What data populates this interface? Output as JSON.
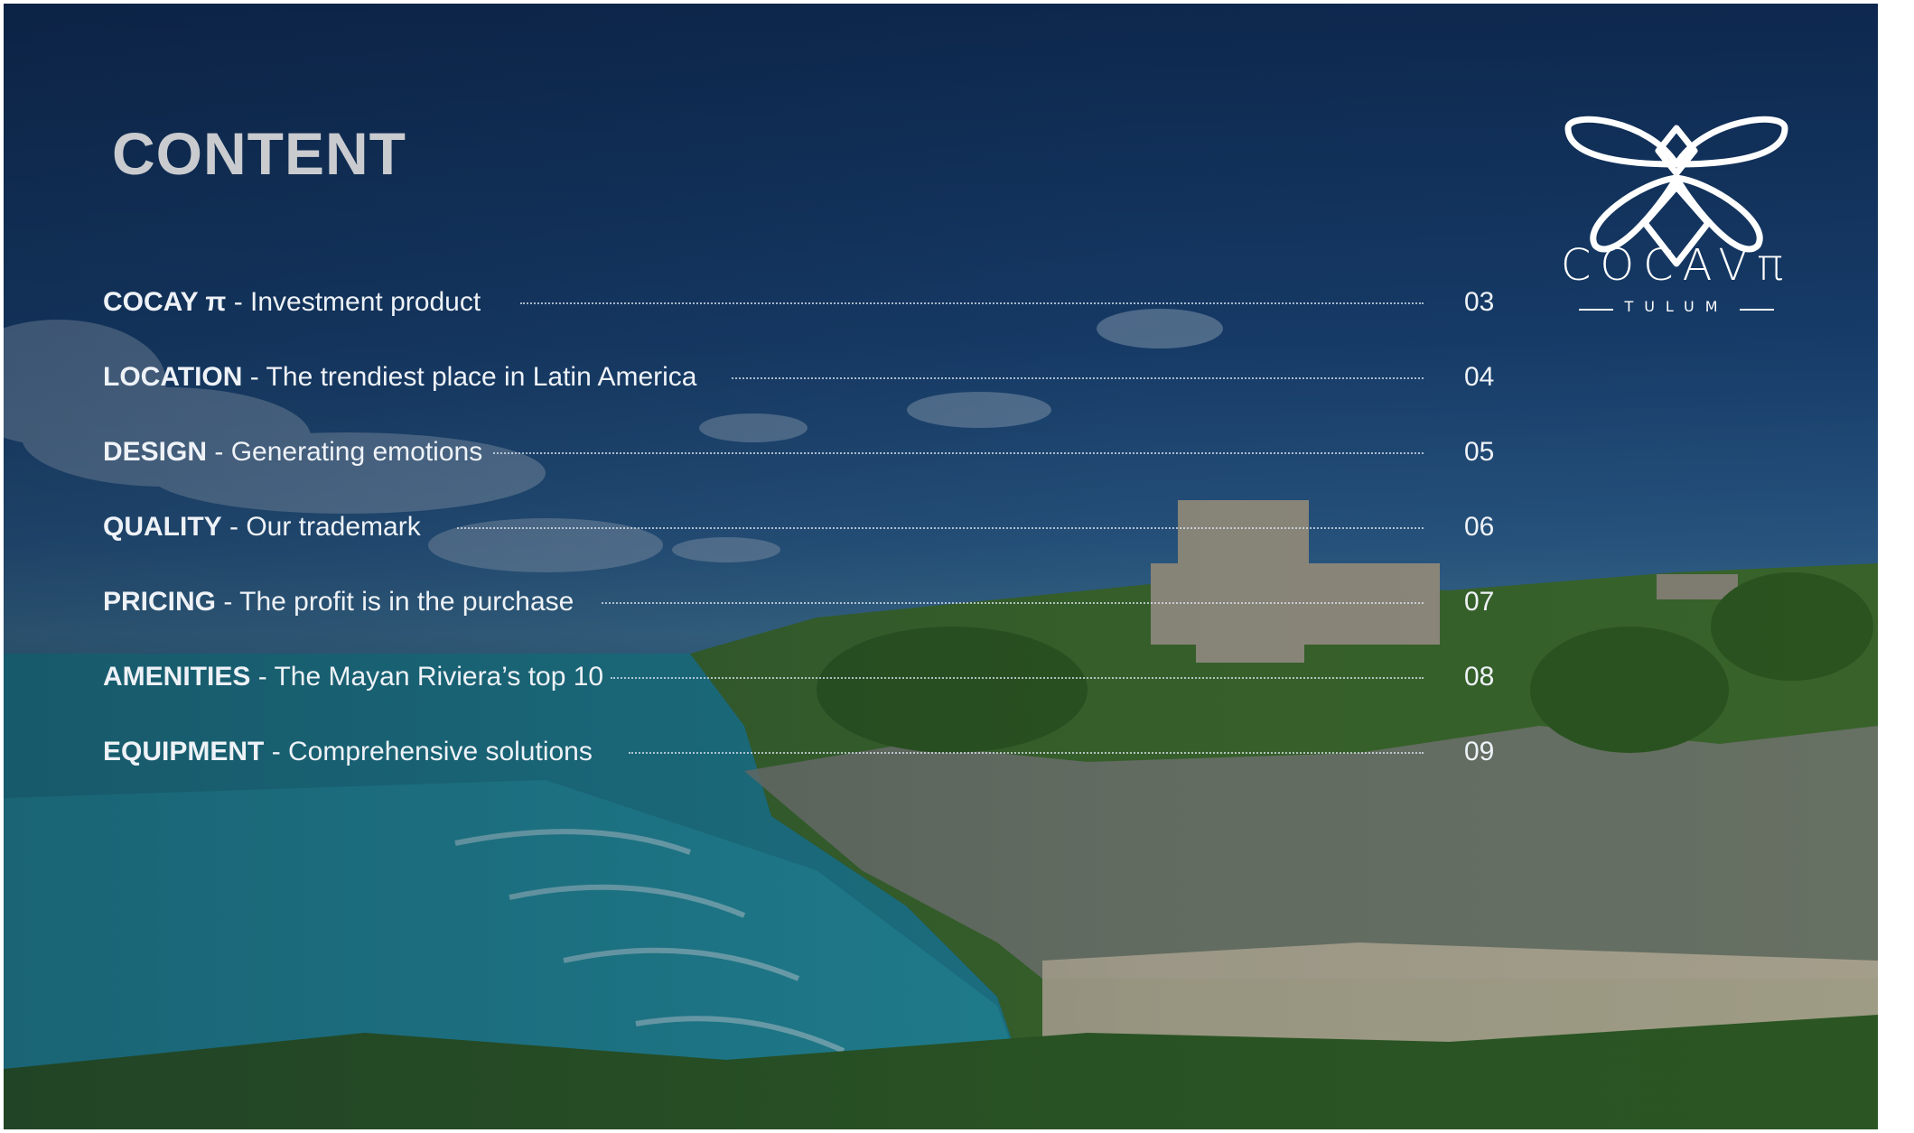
{
  "title": "CONTENT",
  "toc": [
    {
      "key": "COCAY π",
      "desc": " - Investment product",
      "page": "03"
    },
    {
      "key": "LOCATION",
      "desc": " - The trendiest place in Latin America",
      "page": "04"
    },
    {
      "key": "DESIGN",
      "desc": " - Generating emotions",
      "page": "05"
    },
    {
      "key": "QUALITY",
      "desc": " - Our trademark",
      "page": "06"
    },
    {
      "key": "PRICING",
      "desc": " - The profit is in the purchase",
      "page": "07"
    },
    {
      "key": "AMENITIES",
      "desc": " - The Mayan Riviera’s top 10",
      "page": "08"
    },
    {
      "key": "EQUIPMENT",
      "desc": " - Comprehensive solutions",
      "page": "09"
    }
  ],
  "logo": {
    "brand": "COCAVπ",
    "sub": "TULUM",
    "icon": "dragonfly-icon"
  },
  "colors": {
    "text": "#eef2f7",
    "title": "#c9cbcf",
    "sky": "#18406f",
    "sea": "#2a8f9c",
    "vegetation": "#3d6b2a"
  }
}
